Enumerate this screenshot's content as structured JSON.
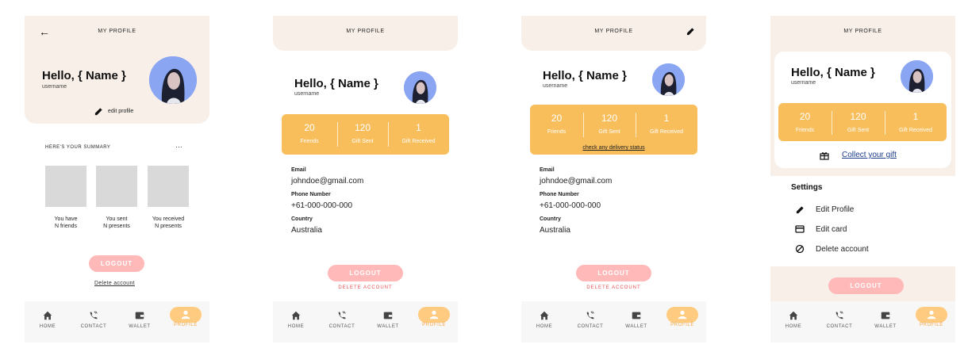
{
  "header": {
    "title": "MY PROFILE"
  },
  "greeting": "Hello, { Name }",
  "username": "username",
  "edit_profile": "edit profile",
  "summary": {
    "heading": "HERE'S YOUR SUMMARY",
    "more": "···",
    "cards": [
      {
        "line1": "You have",
        "line2": "N friends"
      },
      {
        "line1": "You sent",
        "line2": "N presents"
      },
      {
        "line1": "You received",
        "line2": "N presents"
      }
    ]
  },
  "stats": [
    {
      "value": "20",
      "label": "Friends"
    },
    {
      "value": "120",
      "label": "Gift Sent"
    },
    {
      "value": "1",
      "label": "Gift Received"
    }
  ],
  "delivery_link": "check any delivery status",
  "info": {
    "email_label": "Email",
    "email": "johndoe@gmail.com",
    "phone_label": "Phone Number",
    "phone": "+61-000-000-000",
    "country_label": "Country",
    "country": "Australia"
  },
  "gift_link": "Collect your gift",
  "settings": {
    "heading": "Settings",
    "items": [
      "Edit Profile",
      "Edit card",
      "Delete account"
    ]
  },
  "logout": "LOGOUT",
  "delete_account_link": "Delete account",
  "delete_account_caps": "DELETE ACCOUNT",
  "nav": [
    "HOME",
    "CONTACT",
    "WALLET",
    "PROFILE"
  ],
  "colors": {
    "accent": "#f8be5c",
    "beige": "#f7efe8",
    "logout": "#ffb9b9",
    "nav_active": "#ffcb80",
    "link": "#1a3a8a",
    "danger": "#e25050"
  }
}
